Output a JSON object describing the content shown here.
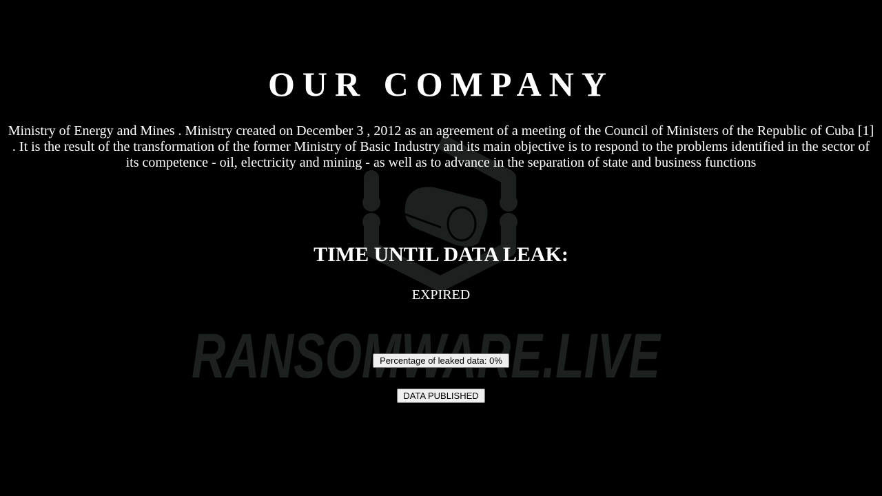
{
  "page": {
    "title": "OUR COMPANY",
    "description": "Ministry of Energy and Mines . Ministry created on December 3 , 2012 as an agreement of a meeting of the Council of Ministers of the Republic of Cuba [1] . It is the result of the transformation of the former Ministry of Basic Industry and its main objective is to respond to the problems identified in the sector of its competence - oil, electricity and mining - as well as to advance in the separation of state and business functions"
  },
  "timer": {
    "heading": "TIME UNTIL DATA LEAK:",
    "status": "EXPIRED"
  },
  "buttons": {
    "percentage_label": "Percentage of leaked data: 0%",
    "published_label": "DATA PUBLISHED"
  },
  "watermark": {
    "text": "RANSOMWARE.LIVE",
    "icon": "security-camera-hexagon-icon",
    "color": "#1c2120"
  },
  "colors": {
    "background": "#000000",
    "text": "#ffffff"
  }
}
